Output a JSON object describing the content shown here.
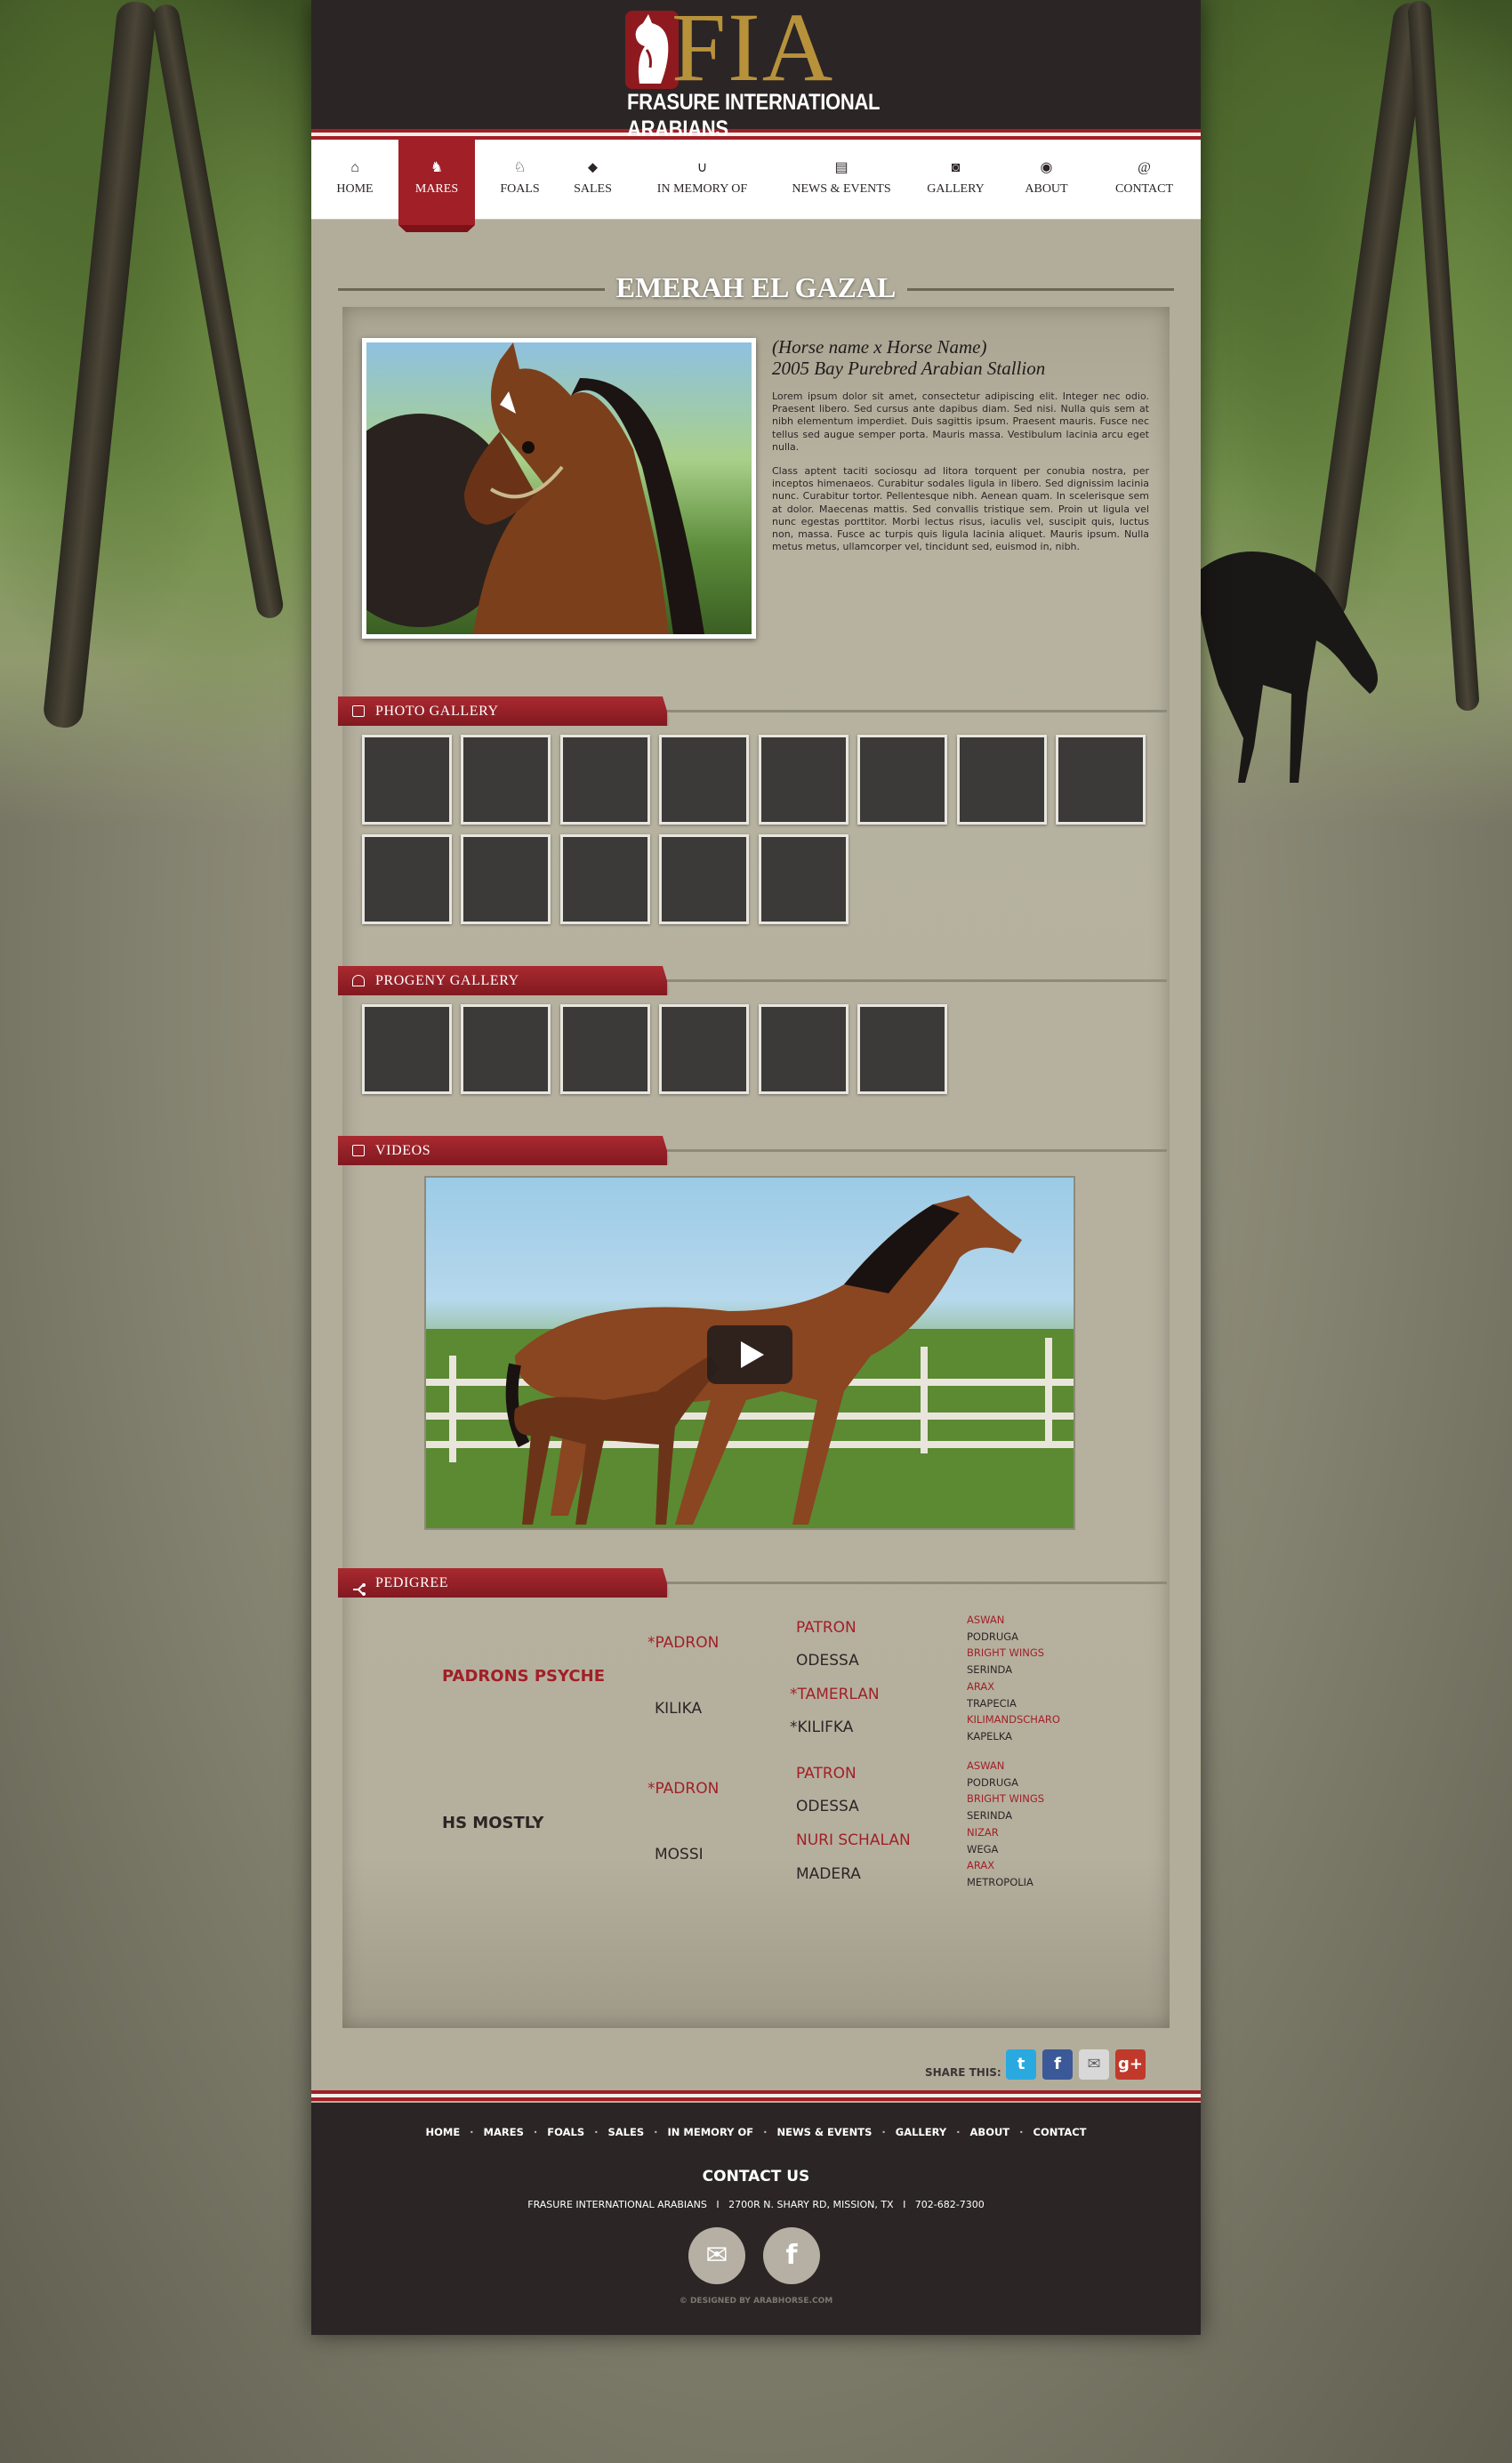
{
  "brand": {
    "letters": "FIA",
    "name": "FRASURE INTERNATIONAL ARABIANS",
    "color_red": "#a11f27",
    "color_gold": "#b8923a",
    "color_dark": "#2b2526"
  },
  "nav": {
    "items": [
      {
        "label": "HOME",
        "icon": "house-icon"
      },
      {
        "label": "MARES",
        "icon": "horse-head-icon",
        "active": true
      },
      {
        "label": "FOALS",
        "icon": "foal-icon"
      },
      {
        "label": "SALES",
        "icon": "tag-icon"
      },
      {
        "label": "IN MEMORY OF",
        "icon": "horseshoe-icon"
      },
      {
        "label": "NEWS & EVENTS",
        "icon": "newspaper-icon"
      },
      {
        "label": "GALLERY",
        "icon": "camera-icon"
      },
      {
        "label": "ABOUT",
        "icon": "info-circle-icon"
      },
      {
        "label": "CONTACT",
        "icon": "at-sign-icon"
      }
    ]
  },
  "horse": {
    "name": "EMERAH EL GAZAL",
    "parentage": "(Horse name x Horse Name)",
    "description_line": "2005 Bay Purebred Arabian Stallion",
    "paragraph1": "Lorem ipsum dolor sit amet, consectetur adipiscing elit. Integer nec odio. Praesent libero. Sed cursus ante dapibus diam. Sed nisi. Nulla quis sem at nibh elementum imperdiet. Duis sagittis ipsum. Praesent mauris. Fusce nec tellus sed augue semper porta. Mauris massa. Vestibulum lacinia arcu eget nulla.",
    "paragraph2": "Class aptent taciti sociosqu ad litora torquent per conubia nostra, per inceptos himenaeos. Curabitur sodales ligula in libero. Sed dignissim lacinia nunc. Curabitur tortor. Pellentesque nibh. Aenean quam. In scelerisque sem at dolor. Maecenas mattis. Sed convallis tristique sem. Proin ut ligula vel nunc egestas porttitor. Morbi lectus risus, iaculis vel, suscipit quis, luctus non, massa. Fusce ac turpis quis ligula lacinia aliquet. Mauris ipsum. Nulla metus metus, ullamcorper vel, tincidunt sed, euismod in, nibh."
  },
  "sections": {
    "photo_gallery": {
      "title": "PHOTO GALLERY",
      "icon": "image-icon",
      "thumb_count": 13
    },
    "progeny_gallery": {
      "title": "PROGENY GALLERY",
      "icon": "horse-head-icon",
      "thumb_count": 6
    },
    "videos": {
      "title": "VIDEOS",
      "icon": "film-icon"
    },
    "pedigree": {
      "title": "PEDIGREE",
      "icon": "tree-branch-icon"
    }
  },
  "pedigree": {
    "sire": "PADRONS PSYCHE",
    "dam": "HS MOSTLY",
    "gen2": [
      "*PADRON",
      "KILIKA",
      "*PADRON",
      "MOSSI"
    ],
    "gen3": [
      "PATRON",
      "ODESSA",
      "*TAMERLAN",
      "*KILIFKA",
      "PATRON",
      "ODESSA",
      "NURI SCHALAN",
      "MADERA"
    ],
    "gen4": [
      "ASWAN",
      "PODRUGA",
      "BRIGHT WINGS",
      "SERINDA",
      "ARAX",
      "TRAPECIA",
      "KILIMANDSCHARO",
      "KAPELKA",
      "ASWAN",
      "PODRUGA",
      "BRIGHT WINGS",
      "SERINDA",
      "NIZAR",
      "WEGA",
      "ARAX",
      "METROPOLIA"
    ]
  },
  "share": {
    "label": "SHARE THIS:",
    "buttons": [
      {
        "icon": "twitter-icon",
        "glyph": "t",
        "color": "#2aa9e0"
      },
      {
        "icon": "facebook-icon",
        "glyph": "f",
        "color": "#3b5998"
      },
      {
        "icon": "email-icon",
        "glyph": "✉",
        "color": "#d8d8d8"
      },
      {
        "icon": "google-plus-icon",
        "glyph": "g+",
        "color": "#c0392b"
      }
    ]
  },
  "footer": {
    "nav": [
      "HOME",
      "MARES",
      "FOALS",
      "SALES",
      "IN MEMORY OF",
      "NEWS & EVENTS",
      "GALLERY",
      "ABOUT",
      "CONTACT"
    ],
    "contact_title": "CONTACT US",
    "address": "FRASURE INTERNATIONAL ARABIANS   I   2700R N. SHARY RD, MISSION, TX   I   702-682-7300",
    "credit": "© DESIGNED BY ARABHORSE.COM"
  }
}
